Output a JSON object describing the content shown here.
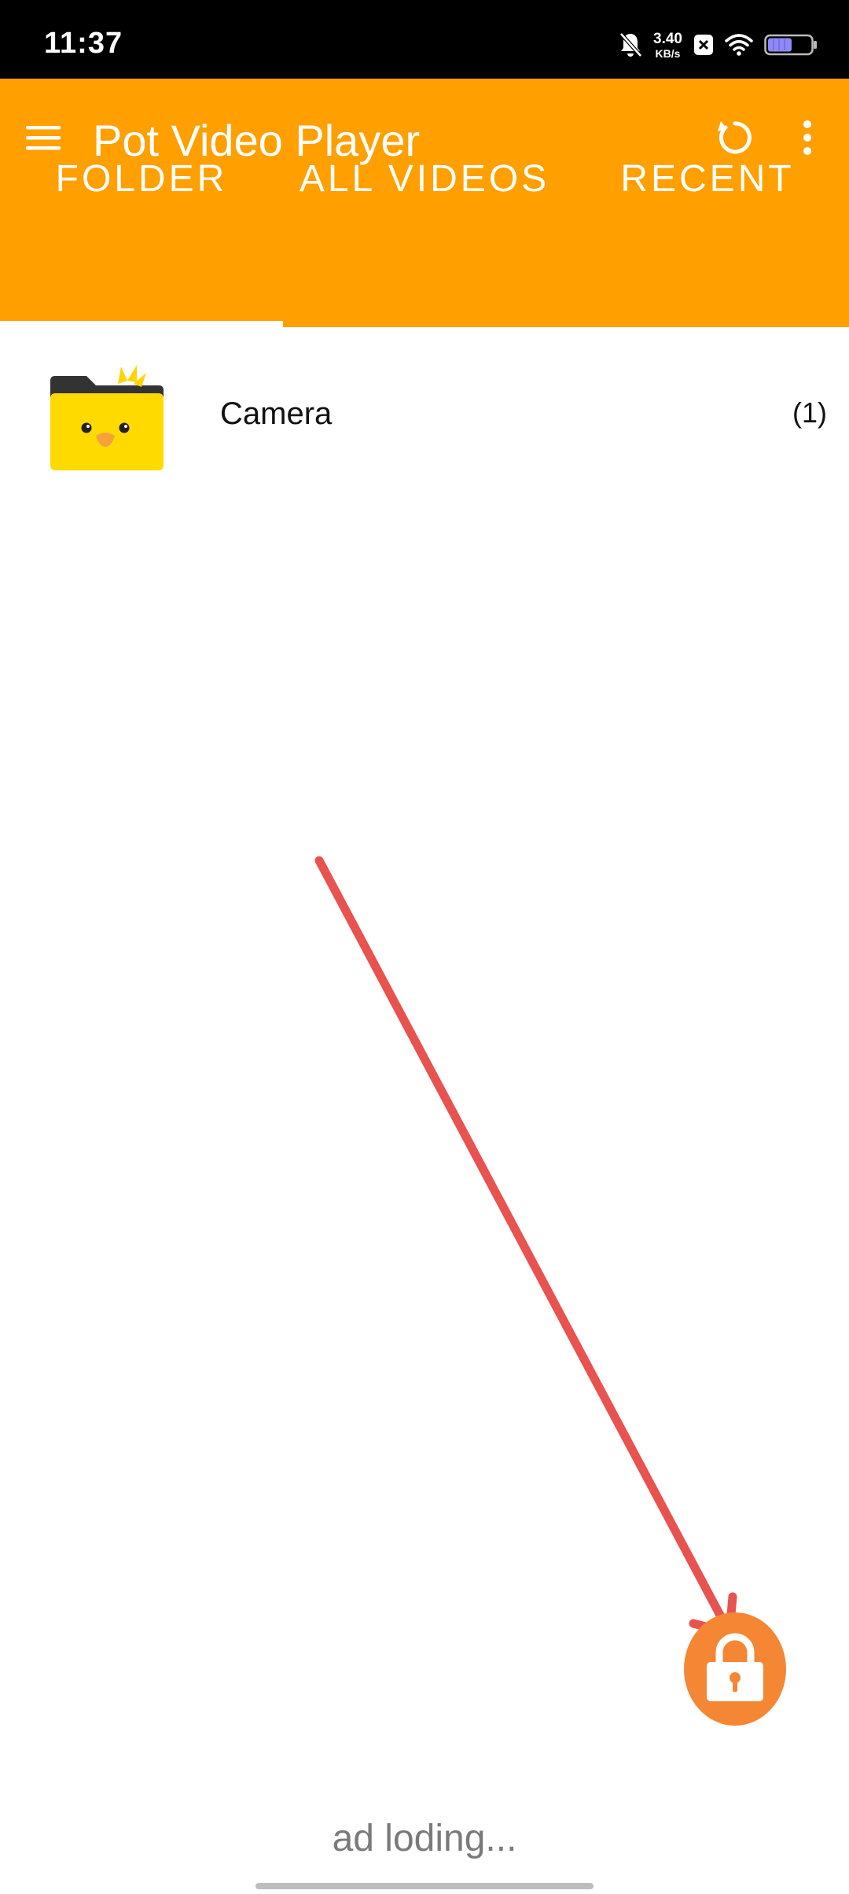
{
  "status_bar": {
    "time": "11:37",
    "net_speed_value": "3.40",
    "net_speed_unit": "KB/s",
    "icons": [
      "bell-off-icon",
      "close-box-icon",
      "wifi-icon",
      "battery-icon"
    ]
  },
  "app_bar": {
    "title": "Pot Video Player",
    "color": "#FF9F00",
    "icons": [
      "menu-icon",
      "refresh-icon",
      "more-vert-icon"
    ]
  },
  "tabs": [
    {
      "label": "FOLDER",
      "selected": true
    },
    {
      "label": "ALL VIDEOS",
      "selected": false
    },
    {
      "label": "RECENT",
      "selected": false
    }
  ],
  "folders": [
    {
      "name": "Camera",
      "count": "(1)",
      "icon": "duck-folder-icon"
    }
  ],
  "fab": {
    "icon": "lock-icon",
    "color": "#F58634"
  },
  "annotation": {
    "arrow_color": "#E8534F"
  },
  "footer": {
    "ad_text": "ad loding..."
  }
}
